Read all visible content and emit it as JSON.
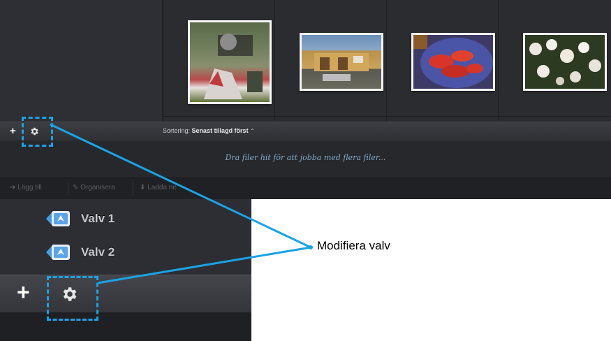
{
  "sorting": {
    "label": "Sortering:",
    "value": "Senast tillagd först",
    "caret": "⌃"
  },
  "drop_zone": {
    "text": "Dra filer hit för att jobba med flera filer..."
  },
  "actions": {
    "add_label": "Lägg till",
    "organize_label": "Organisera",
    "download_label": "Ladda ne"
  },
  "vaults": [
    {
      "label": "Valv 1"
    },
    {
      "label": "Valv 2"
    }
  ],
  "callout": {
    "text": "Modifiera valv"
  },
  "colors": {
    "callout": "#1aa3e6",
    "accent": "#7fa8c9"
  }
}
